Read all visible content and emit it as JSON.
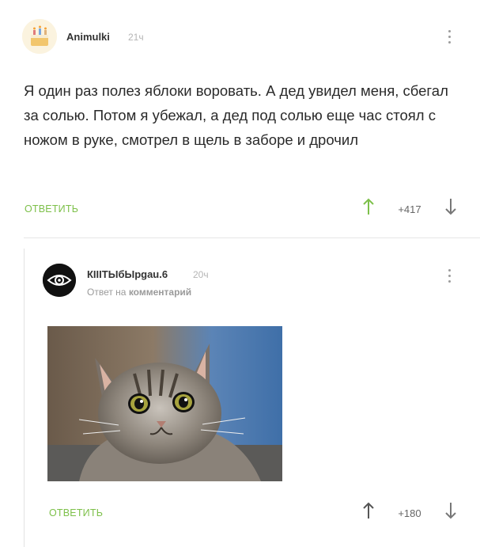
{
  "comments": [
    {
      "author": "Animulki",
      "time": "21ч",
      "text": "Я один раз полез яблоки воровать. А дед увидел меня, сбегал за солью. Потом я убежал, а дед под солью еще час стоял с ножом в руке, смотрел в щель в заборе и дрочил",
      "reply_label": "ОТВЕТИТЬ",
      "score": "+417",
      "upvote_icon": "arrow-up-icon",
      "downvote_icon": "arrow-down-icon",
      "menu_icon": "more-vertical-icon",
      "avatar_icon": "cake-avatar"
    },
    {
      "author": "КIIIТЫбЫрgau.6",
      "time": "20ч",
      "reply_to_prefix": "Ответ на",
      "reply_to_link": "комментарий",
      "reply_label": "ОТВЕТИТЬ",
      "score": "+180",
      "upvote_icon": "arrow-up-icon",
      "downvote_icon": "arrow-down-icon",
      "menu_icon": "more-vertical-icon",
      "avatar_icon": "eye-avatar",
      "image": "surprised-cat-photo"
    }
  ],
  "colors": {
    "accent": "#7dc04a",
    "muted": "#9a9a9a",
    "text": "#2a2a2a"
  }
}
